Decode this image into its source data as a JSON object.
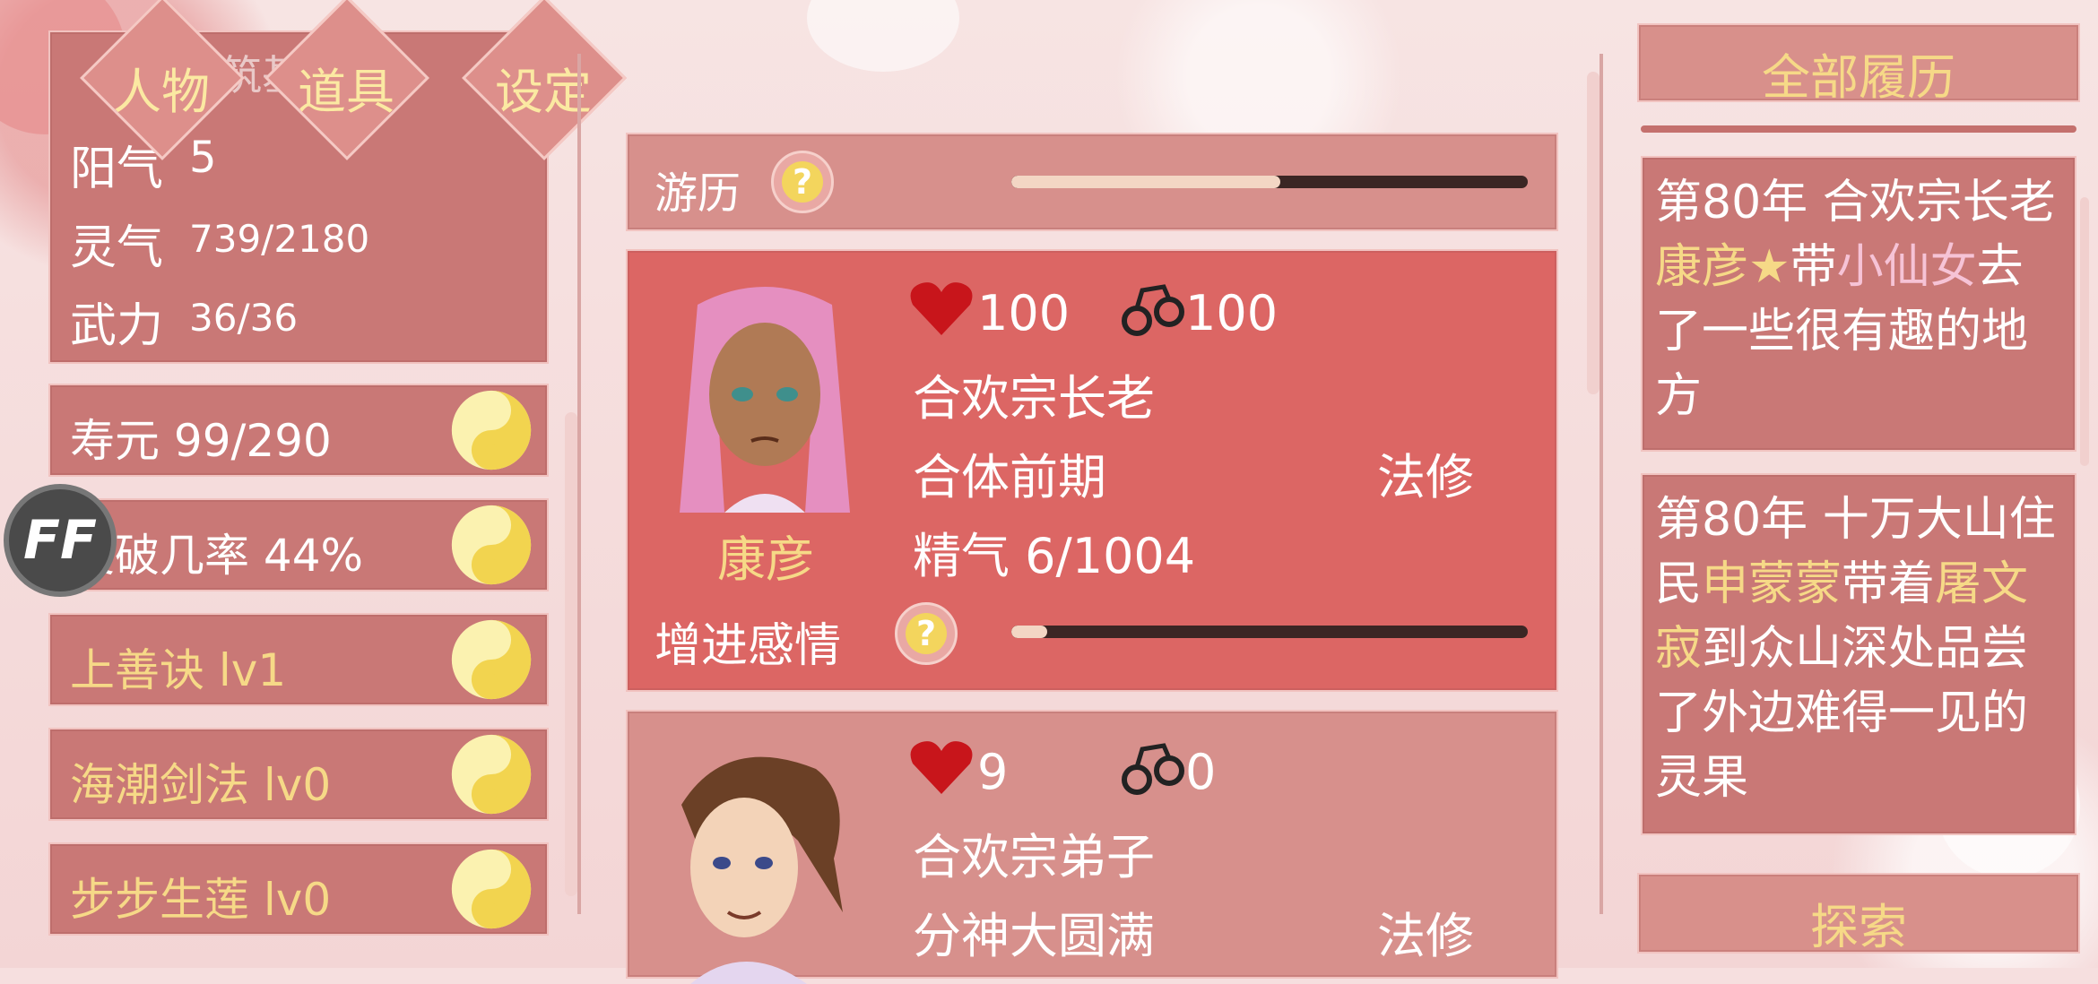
{
  "tabs": [
    {
      "label": "人物"
    },
    {
      "label": "道具"
    },
    {
      "label": "设定"
    }
  ],
  "stats": {
    "hidden_row": "筑基",
    "yangqi_label": "阳气",
    "yangqi_value": "5",
    "lingqi_label": "灵气",
    "lingqi_value": "739/2180",
    "wuli_label": "武力",
    "wuli_value": "36/36"
  },
  "skills": [
    {
      "label": "寿元 99/290",
      "gold": false
    },
    {
      "label": "突破几率 44%",
      "gold": false
    },
    {
      "label": "上善诀 lv1",
      "gold": true
    },
    {
      "label": "海潮剑法 lv0",
      "gold": true
    },
    {
      "label": "步步生莲 lv0",
      "gold": true
    }
  ],
  "ff_button": "FF",
  "travel": {
    "label": "游历",
    "help": "?",
    "progress": 0.52
  },
  "characters": [
    {
      "name": "康彦",
      "heart": "100",
      "bond": "100",
      "title": "合欢宗长老",
      "realm": "合体前期",
      "path": "法修",
      "essence": "精气 6/1004",
      "affection_label": "增进感情",
      "affection_help": "?",
      "affection_progress": 0.07,
      "hair_color": "#e58fc0",
      "skin_color": "#b07a55"
    },
    {
      "name": "",
      "heart": "9",
      "bond": "0",
      "title": "合欢宗弟子",
      "realm": "分神大圆满",
      "path": "法修",
      "hair_color": "#6b4026",
      "skin_color": "#f3d3b8"
    }
  ],
  "history": {
    "header": "全部履历",
    "entries": [
      {
        "segments": [
          {
            "text": "第80年 合欢宗长老",
            "gold": false
          },
          {
            "text": "康彦★",
            "gold": true
          },
          {
            "text": "带",
            "gold": false
          },
          {
            "text": "小仙女",
            "gold": false,
            "pink": true
          },
          {
            "text": "去了一些很有趣的地方",
            "gold": false
          }
        ]
      },
      {
        "segments": [
          {
            "text": "第80年 十万大山住民",
            "gold": false
          },
          {
            "text": "申蒙蒙",
            "gold": true
          },
          {
            "text": "带着",
            "gold": false
          },
          {
            "text": "屠文寂",
            "gold": true
          },
          {
            "text": "到众山深处品尝了外边难得一见的灵果",
            "gold": false
          }
        ]
      }
    ],
    "explore_button": "探索"
  },
  "colors": {
    "panel": "#c97876",
    "active_card": "#dc6664",
    "gold_text": "#f6d987",
    "heart": "#c8151b"
  }
}
